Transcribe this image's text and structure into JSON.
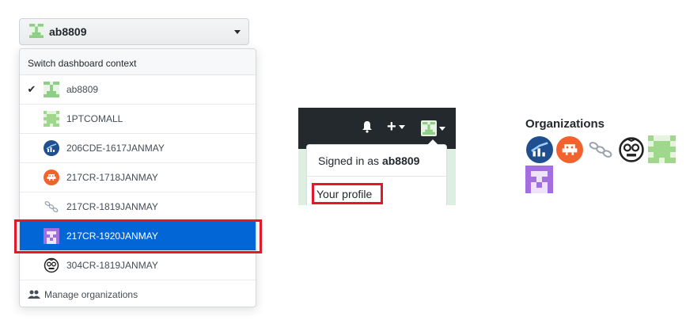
{
  "context_switcher": {
    "current_user": "ab8809",
    "menu_header": "Switch dashboard context",
    "items": [
      {
        "label": "ab8809",
        "checked": true,
        "avatar": "green-identicon"
      },
      {
        "label": "1PTCOMALL",
        "checked": false,
        "avatar": "green-cross-identicon"
      },
      {
        "label": "206CDE-1617JANMAY",
        "checked": false,
        "avatar": "blue-chart-logo"
      },
      {
        "label": "217CR-1718JANMAY",
        "checked": false,
        "avatar": "orange-invader-logo"
      },
      {
        "label": "217CR-1819JANMAY",
        "checked": false,
        "avatar": "chain-logo"
      },
      {
        "label": "217CR-1920JANMAY",
        "checked": false,
        "selected": true,
        "avatar": "purple-identicon"
      },
      {
        "label": "304CR-1819JANMAY",
        "checked": false,
        "avatar": "zombie-face-logo"
      }
    ],
    "manage_label": "Manage organizations"
  },
  "header_dropdown": {
    "signed_in_prefix": "Signed in as",
    "signed_in_user": "ab8809",
    "your_profile": "Your profile",
    "plus_glyph": "+"
  },
  "organizations": {
    "title": "Organizations",
    "avatars": [
      "blue-chart-logo",
      "orange-invader-logo",
      "chain-logo",
      "zombie-face-logo",
      "green-cross-identicon",
      "purple-identicon"
    ]
  },
  "colors": {
    "selected_blue": "#0366d6",
    "highlight_red": "#e3182a",
    "header_dark": "#24292e"
  }
}
